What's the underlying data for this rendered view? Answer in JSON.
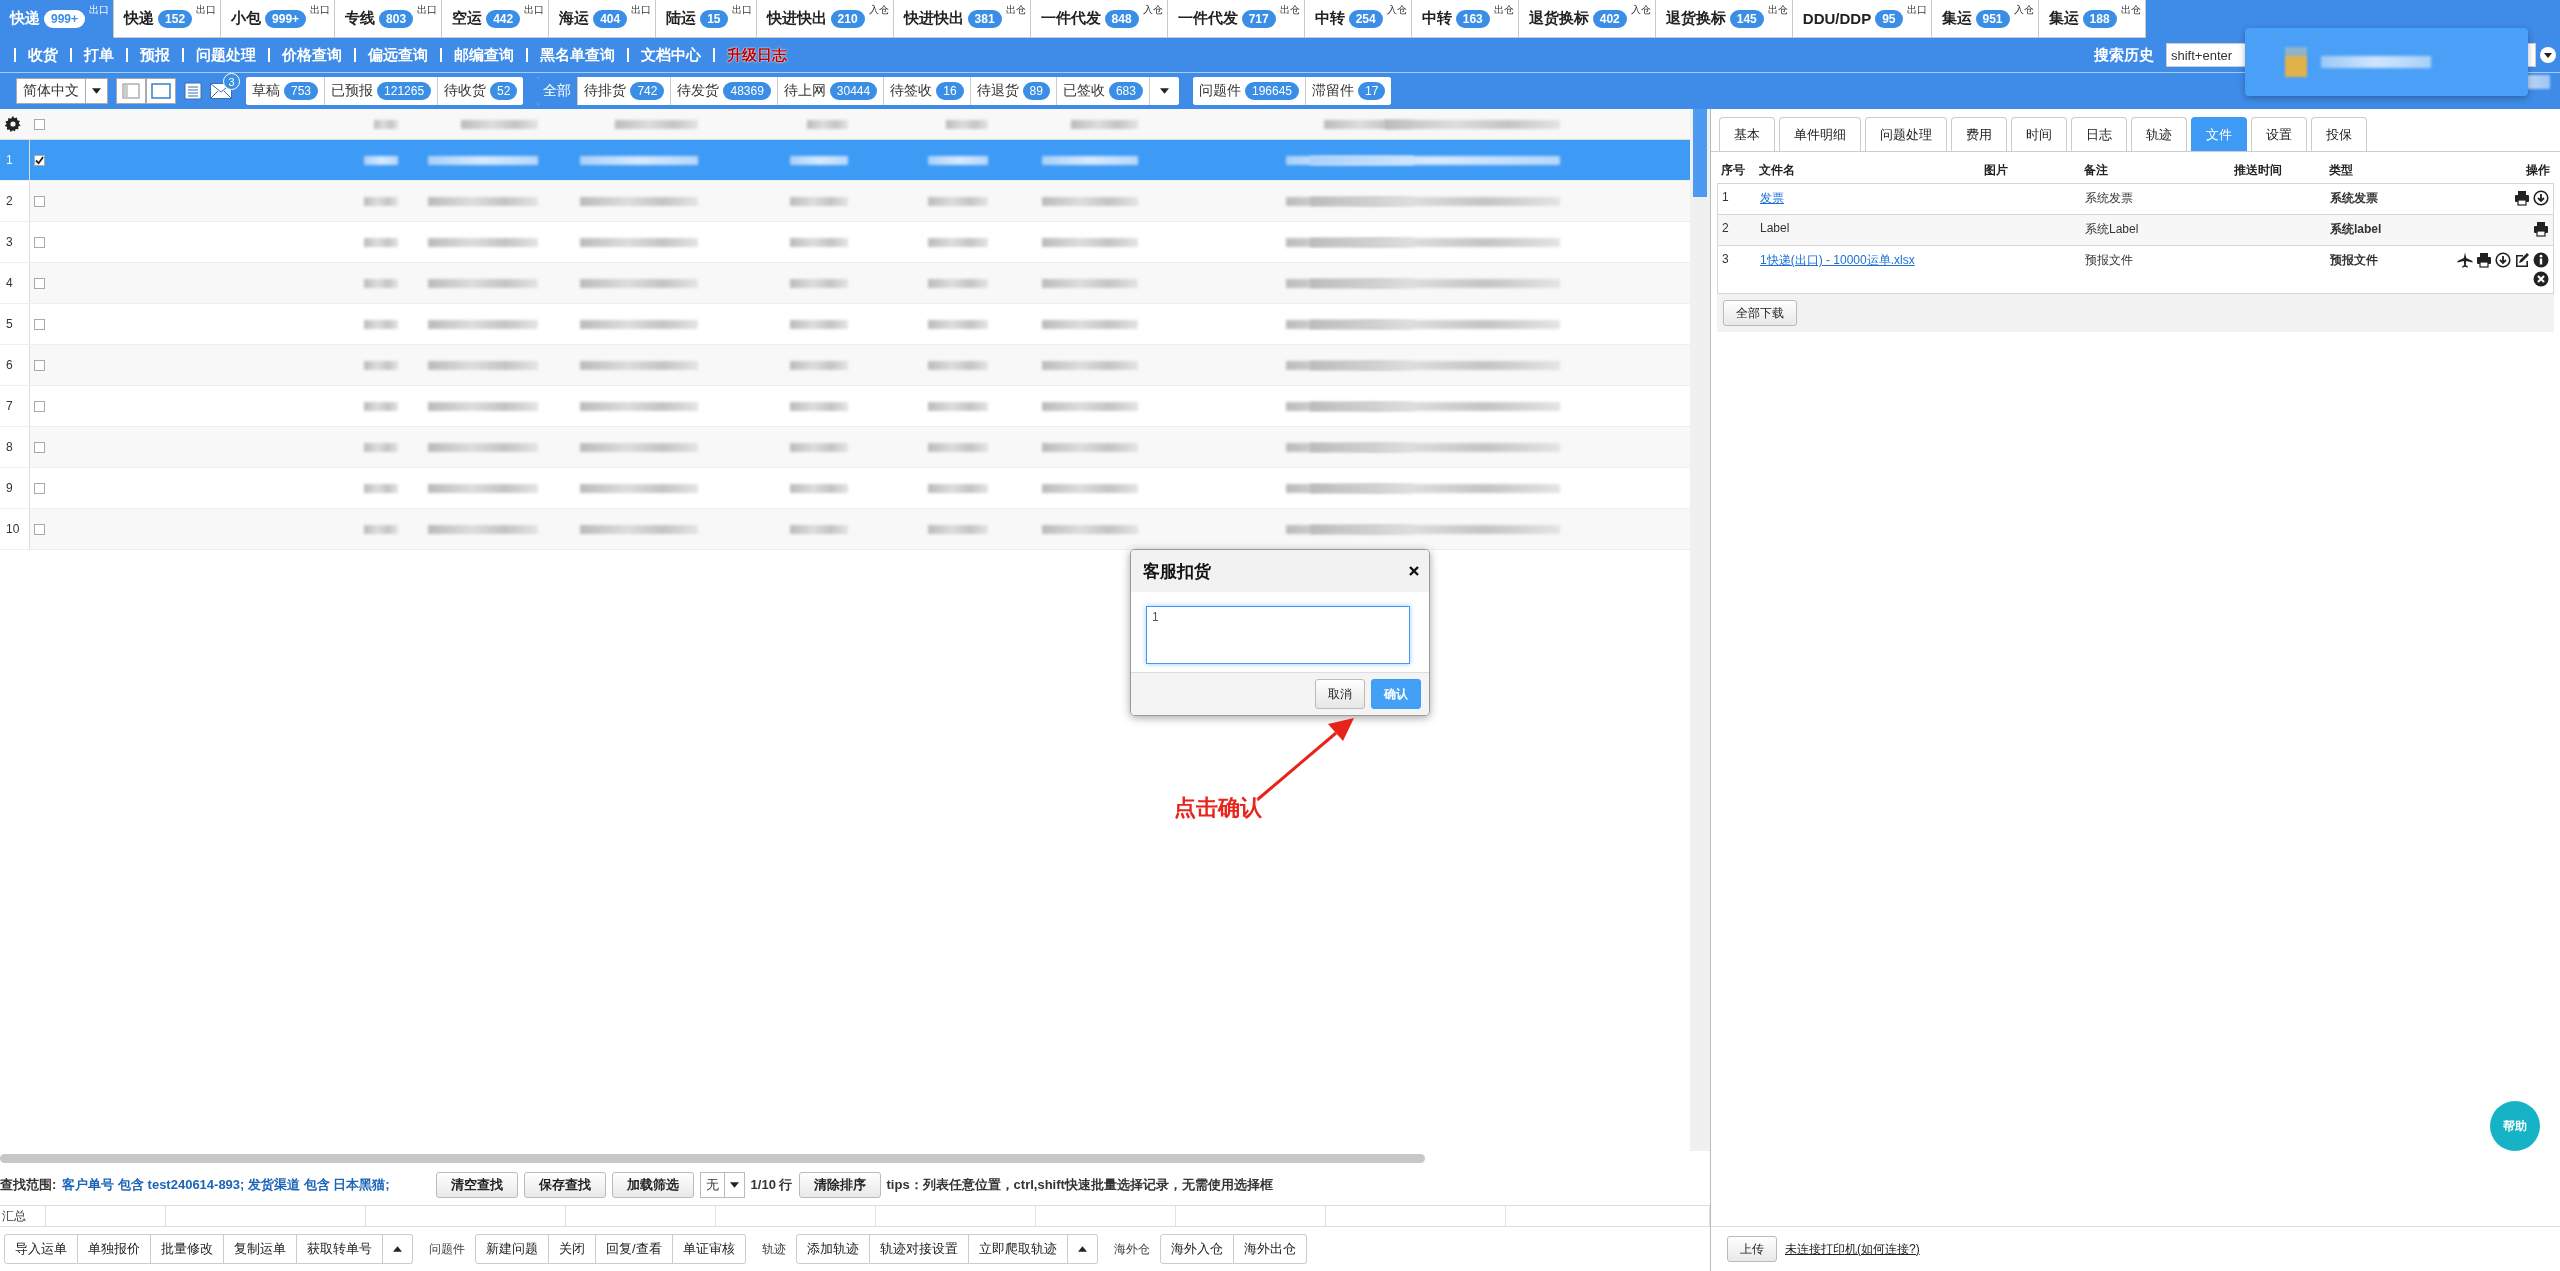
{
  "top_tabs": [
    {
      "label": "快递",
      "count": "999+",
      "tag": "出口",
      "selected": true
    },
    {
      "label": "快递",
      "count": "152",
      "tag": "出口",
      "selected": false
    },
    {
      "label": "小包",
      "count": "999+",
      "tag": "出口",
      "selected": false
    },
    {
      "label": "专线",
      "count": "803",
      "tag": "出口",
      "selected": false
    },
    {
      "label": "空运",
      "count": "442",
      "tag": "出口",
      "selected": false
    },
    {
      "label": "海运",
      "count": "404",
      "tag": "出口",
      "selected": false
    },
    {
      "label": "陆运",
      "count": "15",
      "tag": "出口",
      "selected": false
    },
    {
      "label": "快进快出",
      "count": "210",
      "tag": "入仓",
      "selected": false
    },
    {
      "label": "快进快出",
      "count": "381",
      "tag": "出仓",
      "selected": false
    },
    {
      "label": "一件代发",
      "count": "848",
      "tag": "入仓",
      "selected": false
    },
    {
      "label": "一件代发",
      "count": "717",
      "tag": "出仓",
      "selected": false
    },
    {
      "label": "中转",
      "count": "254",
      "tag": "入仓",
      "selected": false
    },
    {
      "label": "中转",
      "count": "163",
      "tag": "出仓",
      "selected": false
    },
    {
      "label": "退货换标",
      "count": "402",
      "tag": "入仓",
      "selected": false
    },
    {
      "label": "退货换标",
      "count": "145",
      "tag": "出仓",
      "selected": false
    },
    {
      "label": "DDU/DDP",
      "count": "95",
      "tag": "出口",
      "selected": false
    },
    {
      "label": "集运",
      "count": "951",
      "tag": "入仓",
      "selected": false
    },
    {
      "label": "集运",
      "count": "188",
      "tag": "出仓",
      "selected": false
    }
  ],
  "nav": {
    "items": [
      {
        "label": "收货",
        "highlight": false
      },
      {
        "label": "打单",
        "highlight": false
      },
      {
        "label": "预报",
        "highlight": false
      },
      {
        "label": "问题处理",
        "highlight": false
      },
      {
        "label": "价格查询",
        "highlight": false
      },
      {
        "label": "偏远查询",
        "highlight": false
      },
      {
        "label": "邮编查询",
        "highlight": false
      },
      {
        "label": "黑名单查询",
        "highlight": false
      },
      {
        "label": "文档中心",
        "highlight": false
      },
      {
        "label": "升级日志",
        "highlight": true
      }
    ],
    "search_history": {
      "label": "搜索历史",
      "placeholder": "shift+enter"
    }
  },
  "toolbar": {
    "language": "简体中文",
    "mail_badge": "3",
    "groups": [
      {
        "has_menu": false,
        "items": [
          {
            "label": "草稿",
            "count": "753",
            "selected": false
          },
          {
            "label": "已预报",
            "count": "121265",
            "selected": false
          },
          {
            "label": "待收货",
            "count": "52",
            "selected": false
          }
        ]
      },
      {
        "has_menu": true,
        "items": [
          {
            "label": "全部",
            "selected": true
          },
          {
            "label": "待排货",
            "count": "742",
            "selected": false
          },
          {
            "label": "待发货",
            "count": "48369",
            "selected": false
          },
          {
            "label": "待上网",
            "count": "30444",
            "selected": false
          },
          {
            "label": "待签收",
            "count": "16",
            "selected": false
          },
          {
            "label": "待退货",
            "count": "89",
            "selected": false
          },
          {
            "label": "已签收",
            "count": "683",
            "selected": false
          }
        ]
      },
      {
        "has_menu": false,
        "items": [
          {
            "label": "问题件",
            "count": "196645",
            "selected": false
          },
          {
            "label": "滞留件",
            "count": "17",
            "selected": false
          }
        ]
      }
    ]
  },
  "grid": {
    "all_checked": false,
    "rows": [
      {
        "number": "1",
        "selected": true,
        "checked": true
      },
      {
        "number": "2",
        "selected": false,
        "checked": false
      },
      {
        "number": "3",
        "selected": false,
        "checked": false
      },
      {
        "number": "4",
        "selected": false,
        "checked": false
      },
      {
        "number": "5",
        "selected": false,
        "checked": false
      },
      {
        "number": "6",
        "selected": false,
        "checked": false
      },
      {
        "number": "7",
        "selected": false,
        "checked": false
      },
      {
        "number": "8",
        "selected": false,
        "checked": false
      },
      {
        "number": "9",
        "selected": false,
        "checked": false
      },
      {
        "number": "10",
        "selected": false,
        "checked": false
      }
    ]
  },
  "search": {
    "label": "查找范围:",
    "criteria": "客户单号 包含 test240614-893; 发货渠道 包含 日本黑猫;",
    "buttons": [
      "清空查找",
      "保存查找",
      "加载筛选"
    ],
    "filter_value": "无",
    "row_info": "1/10 行",
    "sort_button": "清除排序",
    "tips": "tips：列表任意位置，ctrl,shift快速批量选择记录，无需使用选择框"
  },
  "summary_label": "汇总",
  "actions": {
    "groups": [
      {
        "buttons": [
          "导入运单",
          "单独报价",
          "批量修改",
          "复制运单",
          "获取转单号"
        ],
        "has_menu": true
      },
      {
        "label": "问题件",
        "buttons": [
          "新建问题",
          "关闭",
          "回复/查看",
          "单证审核"
        ],
        "has_menu": false
      },
      {
        "label": "轨迹",
        "buttons": [
          "添加轨迹",
          "轨迹对接设置",
          "立即爬取轨迹"
        ],
        "has_menu": true
      },
      {
        "label": "海外仓",
        "buttons": [
          "海外入仓",
          "海外出仓"
        ],
        "has_menu": false
      }
    ]
  },
  "detail": {
    "tabs": [
      {
        "label": "基本",
        "selected": false
      },
      {
        "label": "单件明细",
        "selected": false
      },
      {
        "label": "问题处理",
        "selected": false
      },
      {
        "label": "费用",
        "selected": false
      },
      {
        "label": "时间",
        "selected": false
      },
      {
        "label": "日志",
        "selected": false
      },
      {
        "label": "轨迹",
        "selected": false
      },
      {
        "label": "文件",
        "selected": true
      },
      {
        "label": "设置",
        "selected": false
      },
      {
        "label": "投保",
        "selected": false
      }
    ],
    "columns": [
      "序号",
      "文件名",
      "图片",
      "备注",
      "推送时间",
      "类型",
      "操作"
    ],
    "files": [
      {
        "number": "1",
        "name": "发票",
        "link": true,
        "remark": "系统发票",
        "type": "系统发票",
        "actions": [
          {
            "kind": "print"
          },
          {
            "kind": "download"
          }
        ]
      },
      {
        "number": "2",
        "name": "Label",
        "link": false,
        "remark": "系统Label",
        "type": "系统label",
        "actions": [
          {
            "kind": "print"
          }
        ]
      },
      {
        "number": "3",
        "name": "1快递(出口) - 10000运单.xlsx",
        "link": true,
        "remark": "预报文件",
        "type": "预报文件",
        "actions": [
          {
            "kind": "plane"
          },
          {
            "kind": "print"
          },
          {
            "kind": "download"
          },
          {
            "kind": "edit"
          },
          {
            "kind": "info"
          },
          {
            "kind": "delete"
          }
        ]
      }
    ],
    "download_all": "全部下载",
    "upload": "上传",
    "printer_link": "未连接打印机(如何连接?)",
    "help": "帮助"
  },
  "dialog": {
    "title": "客服扣货",
    "value": "1",
    "buttons": [
      {
        "label": "取消",
        "kind": "secondary"
      },
      {
        "label": "确认",
        "kind": "primary"
      }
    ]
  },
  "annotation": {
    "text": "点击确认"
  }
}
